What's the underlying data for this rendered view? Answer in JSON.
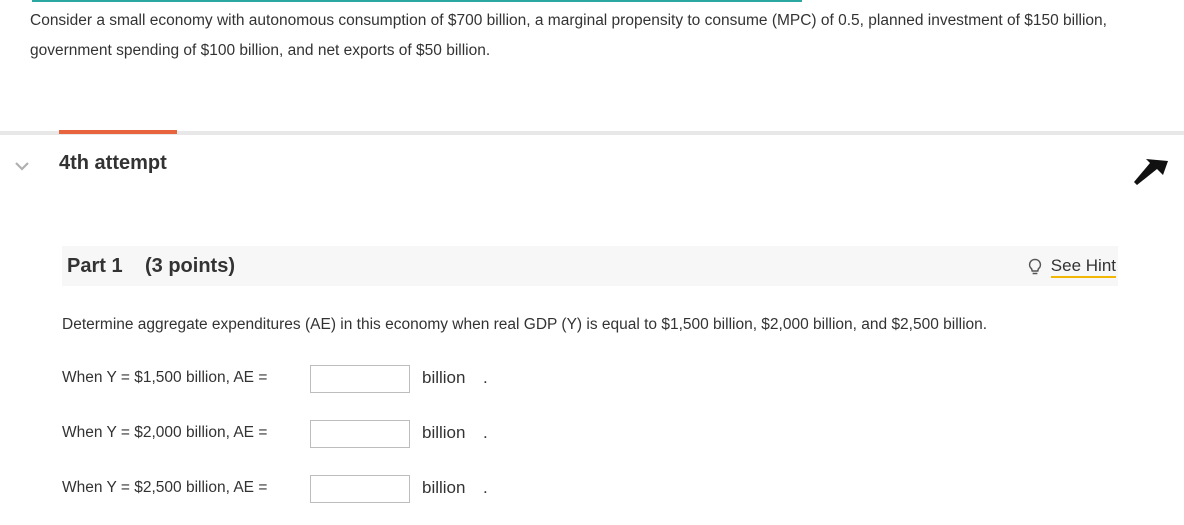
{
  "question": {
    "text": "Consider a small economy with autonomous consumption of $700 billion, a marginal propensity to consume (MPC) of 0.5, planned investment of $150 billion, government spending of $100 billion, and net exports of $50 billion."
  },
  "attempt": {
    "label": "4th attempt",
    "accent_color": "#e8643f"
  },
  "part": {
    "title": "Part 1",
    "points": "(3 points)",
    "hint_label": "See Hint",
    "hint_icon": "lightbulb-icon",
    "instruction": "Determine aggregate expenditures (AE) in this economy when real GDP (Y) is equal to $1,500 billion, $2,000 billion, and $2,500 billion.",
    "rows": [
      {
        "label": "When Y = $1,500 billion, AE =",
        "value": "",
        "unit": "billion",
        "period": "."
      },
      {
        "label": "When Y = $2,000 billion, AE =",
        "value": "",
        "unit": "billion",
        "period": "."
      },
      {
        "label": "When Y = $2,500 billion, AE =",
        "value": "",
        "unit": "billion",
        "period": "."
      }
    ]
  },
  "colors": {
    "teal_accent": "#2aa7a0",
    "hint_underline": "#f2b705"
  }
}
